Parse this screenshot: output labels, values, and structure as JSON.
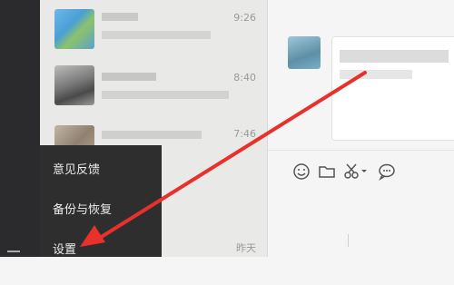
{
  "chat_list": {
    "items": [
      {
        "time": "9:26"
      },
      {
        "time": "8:40"
      },
      {
        "time": "7:46"
      },
      {
        "time": "昨天"
      }
    ]
  },
  "menu": {
    "items": [
      {
        "label": "意见反馈"
      },
      {
        "label": "备份与恢复"
      },
      {
        "label": "设置"
      }
    ]
  },
  "toolbar": {
    "icons": [
      "emoji-icon",
      "folder-icon",
      "scissors-icon",
      "chat-bubble-icon"
    ]
  },
  "colors": {
    "arrow": "#e8312a",
    "menu_bg": "#2e2e2e",
    "nav_bg": "#2b2b2d"
  }
}
